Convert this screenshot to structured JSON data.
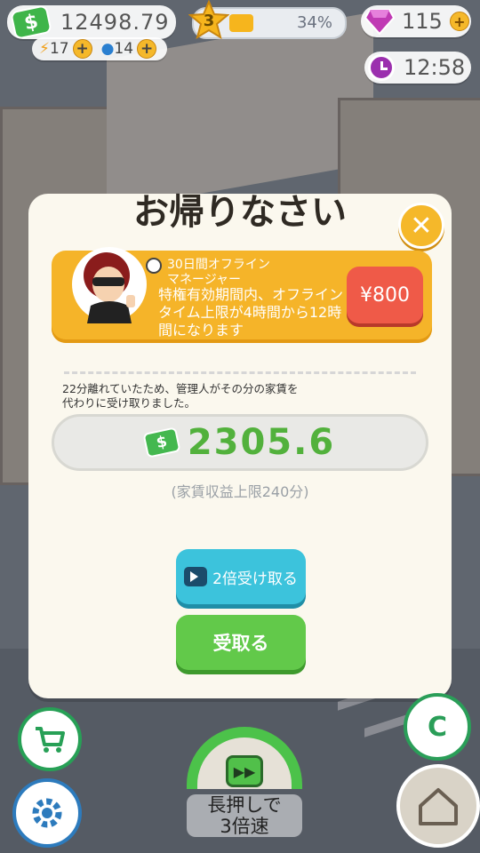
{
  "hud": {
    "money": "12498.79",
    "energy": "17",
    "water": "14",
    "level": "3",
    "level_progress_pct": 34,
    "level_percent_label": "34%",
    "gems": "115",
    "clock_time": "12:58"
  },
  "modal": {
    "title": "お帰りなさい",
    "promo": {
      "title_line1": "30日間オフライン",
      "title_line2": "マネージャー",
      "description": "特権有効期間内、オフラインタイム上限が4時間から12時間になります",
      "price": "¥800"
    },
    "info_line1": "22分離れていたため、管理人がその分の家賃を",
    "info_line2": "代わりに受け取りました。",
    "amount": "2305.6",
    "limit_note": "(家賃収益上限240分)",
    "double_button": "2倍受け取る",
    "receive_button": "受取る"
  },
  "speed_button": {
    "line1": "長押しで",
    "line2": "3倍速"
  },
  "colors": {
    "accent_orange": "#f5b429",
    "money_green": "#52b13c",
    "price_red": "#ef5a48",
    "double_blue": "#3cc3dc",
    "receive_green": "#62c94a"
  }
}
